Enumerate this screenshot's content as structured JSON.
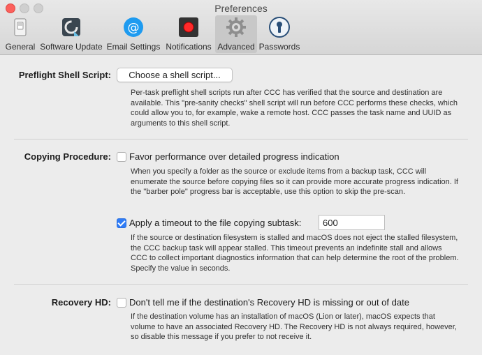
{
  "window": {
    "title": "Preferences"
  },
  "tabs": [
    {
      "label": "General",
      "icon": "switch-icon"
    },
    {
      "label": "Software Update",
      "icon": "ccc-update-icon"
    },
    {
      "label": "Email Settings",
      "icon": "at-sign-icon"
    },
    {
      "label": "Notifications",
      "icon": "record-button-icon"
    },
    {
      "label": "Advanced",
      "icon": "gear-icon"
    },
    {
      "label": "Passwords",
      "icon": "keyhole-icon"
    }
  ],
  "preflight": {
    "label": "Preflight Shell Script:",
    "button": "Choose a shell script...",
    "description": "Per-task preflight shell scripts run after CCC has verified that the source and destination are available. This \"pre-sanity checks\" shell script will run before CCC performs these checks, which could allow you to, for example, wake a remote host. CCC passes the task name and UUID as arguments to this shell script."
  },
  "copying": {
    "label": "Copying Procedure:",
    "favor_performance_label": "Favor performance over detailed progress indication",
    "favor_performance_checked": false,
    "favor_description": "When you specify a folder as the source or exclude items from a backup task, CCC will enumerate the source before copying files so it can provide more accurate progress indication. If the \"barber pole\" progress bar is acceptable, use this option to skip the pre-scan.",
    "timeout_label": "Apply a timeout to the file copying subtask:",
    "timeout_checked": true,
    "timeout_value": "600",
    "timeout_description": "If the source or destination filesystem is stalled and macOS does not eject the stalled filesystem, the CCC backup task will appear stalled. This timeout prevents an indefinite stall and allows CCC to collect important diagnostics information that can help determine the root of the problem. Specify the value in seconds."
  },
  "recovery": {
    "label": "Recovery HD:",
    "checkbox_label": "Don't tell me if the destination's Recovery HD is missing or out of date",
    "checked": false,
    "description": "If the destination volume has an installation of macOS (Lion or later), macOS expects that volume to have an associated Recovery HD. The Recovery HD is not always required, however, so disable this message if you prefer to not receive it."
  },
  "colors": {
    "accent": "#2f7cf6",
    "close": "#fc605c"
  }
}
